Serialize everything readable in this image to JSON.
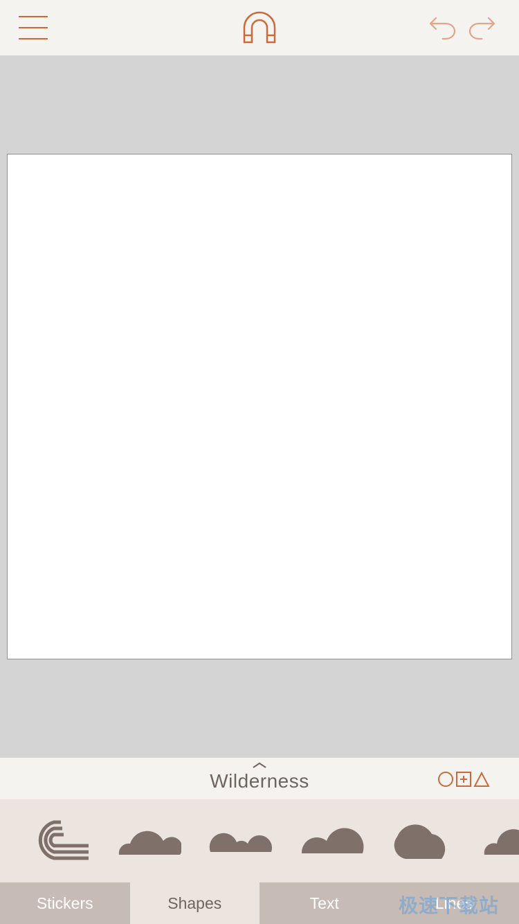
{
  "colors": {
    "accent": "#c96a3a",
    "accent_light": "#e3a587",
    "shape_fill": "#7f706a",
    "toolbar_bg": "#f5f3f0",
    "canvas_bg": "#d4d4d4",
    "artboard_bg": "#ffffff",
    "tray_bg": "#ebe4df",
    "tab_bg": "#c6bbb5"
  },
  "toolbar": {
    "menu_icon": "hamburger-menu-icon",
    "center_icon": "magnet-icon",
    "undo_icon": "undo-arrow-icon",
    "redo_icon": "redo-arrow-icon"
  },
  "category": {
    "title": "Wilderness",
    "caret_icon": "chevron-up-icon",
    "filter_icon": "circle-square-triangle-icon"
  },
  "shapes": [
    {
      "name": "rainbow-stripes-shape"
    },
    {
      "name": "cloud-shape-1"
    },
    {
      "name": "cloud-shape-2"
    },
    {
      "name": "cloud-shape-3"
    },
    {
      "name": "cloud-shape-4"
    },
    {
      "name": "cloud-shape-5"
    }
  ],
  "tabs": [
    {
      "label": "Stickers",
      "active": false
    },
    {
      "label": "Shapes",
      "active": true
    },
    {
      "label": "Text",
      "active": false
    },
    {
      "label": "Lines",
      "active": false
    }
  ],
  "watermark": "极速下载站"
}
